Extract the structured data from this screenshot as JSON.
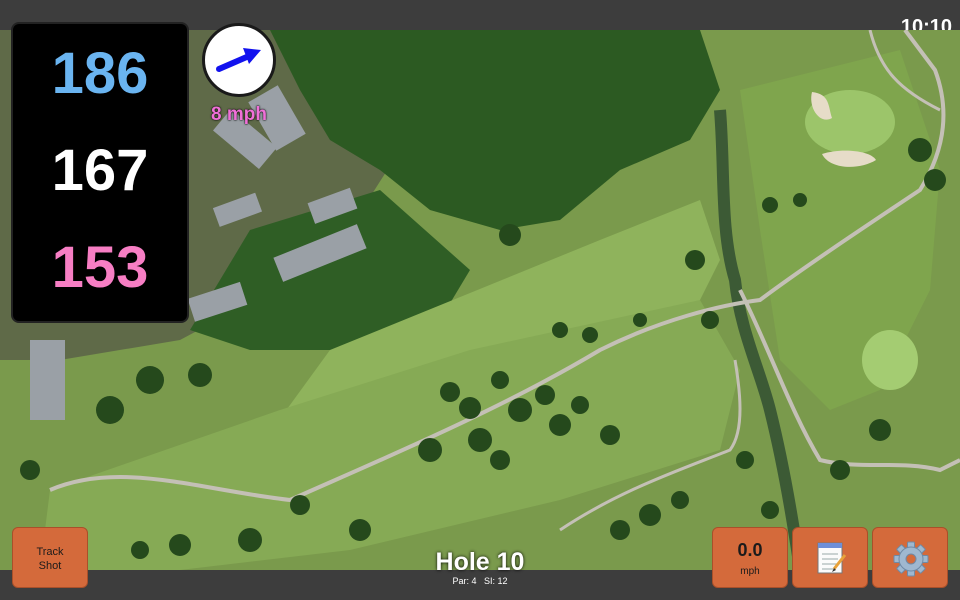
{
  "status": {
    "time": "10:10"
  },
  "distances": {
    "back": "186",
    "middle": "167",
    "front": "153"
  },
  "wind": {
    "speed": "8 mph"
  },
  "buttons": {
    "track_shot": {
      "line1": "Track",
      "line2": "Shot"
    },
    "speed": {
      "value": "0.0",
      "unit": "mph"
    },
    "scorecard": {
      "icon": "notepad-icon"
    },
    "settings": {
      "icon": "gear-icon"
    }
  },
  "hole": {
    "title": "Hole 10",
    "par": "Par: 4",
    "si": "SI: 12"
  },
  "colors": {
    "back": "#6ab4f0",
    "middle": "#ffffff",
    "front": "#f77ec4",
    "button": "#d46a3b",
    "wind_text": "#f070d8",
    "arrow": "#1212ee"
  }
}
